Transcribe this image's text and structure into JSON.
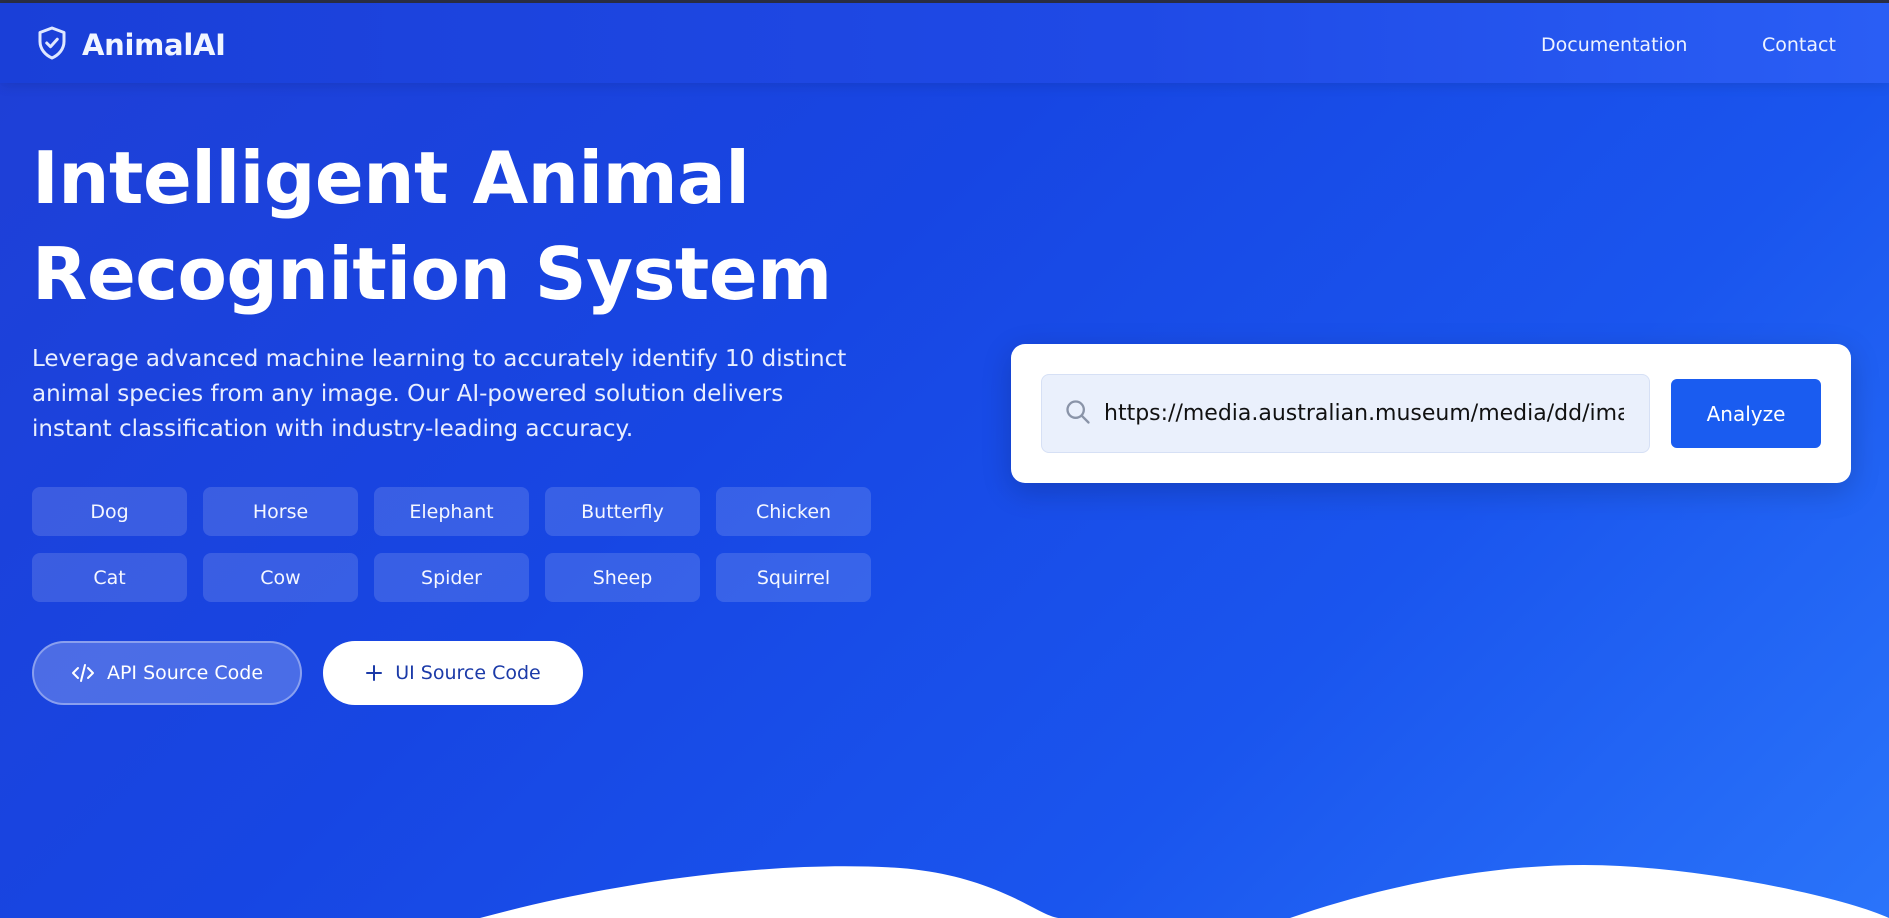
{
  "nav": {
    "brand": "AnimalAI",
    "links": [
      "Documentation",
      "Contact"
    ]
  },
  "hero": {
    "title_line1": "Intelligent Animal",
    "title_line2": "Recognition System",
    "description": "Leverage advanced machine learning to accurately identify 10 distinct animal species from any image. Our AI-powered solution delivers instant classification with industry-leading accuracy.",
    "animals": [
      "Dog",
      "Horse",
      "Elephant",
      "Butterfly",
      "Chicken",
      "Cat",
      "Cow",
      "Spider",
      "Sheep",
      "Squirrel"
    ],
    "api_button": "API Source Code",
    "ui_button": "UI Source Code"
  },
  "search": {
    "value": "https://media.australian.museum/media/dd/image",
    "button": "Analyze"
  },
  "icons": {
    "brand": "shield-check-icon",
    "search": "search-icon",
    "api": "code-icon",
    "ui": "plus-icon"
  },
  "colors": {
    "primary": "#1a5cf0",
    "background_start": "#1f3fd6",
    "background_end": "#2a74fa"
  }
}
